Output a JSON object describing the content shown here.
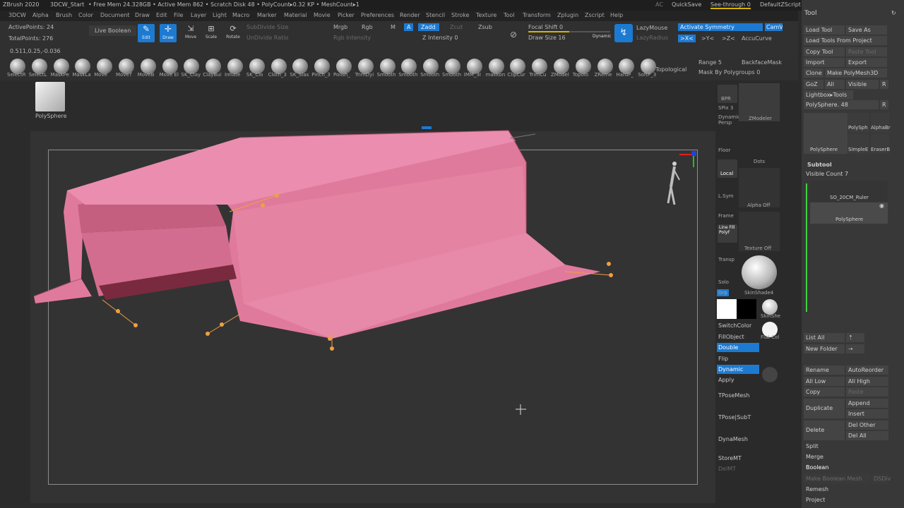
{
  "titlebar": {
    "app": "ZBrush 2020",
    "doc": "3DCW_Start",
    "stats": "• Free Mem 24.328GB • Active Mem 862 • Scratch Disk 48 • PolyCount▸0.32 KP • MeshCount▸1",
    "ac": "AC",
    "quicksave": "QuickSave",
    "seethrough": "See-through 0",
    "script": "DefaultZScript"
  },
  "menu": [
    "3DCW",
    "Alpha",
    "Brush",
    "Color",
    "Document",
    "Draw",
    "Edit",
    "File",
    "Layer",
    "Light",
    "Macro",
    "Marker",
    "Material",
    "Movie",
    "Picker",
    "Preferences",
    "Render",
    "Stencil",
    "Stroke",
    "Texture",
    "Tool",
    "Transform",
    "Zplugin",
    "Zscript",
    "Help"
  ],
  "info": {
    "active_points": "ActivePoints: 24",
    "total_points": "TotalPoints: 276",
    "coords": "0.511,0.25,-0.036"
  },
  "topbar": {
    "live_boolean": "Live Boolean",
    "edit": "Edit",
    "draw": "Draw",
    "move": "Move",
    "scale": "Scale",
    "rotate": "Rotate",
    "subdivide_size": "SubDivide Size",
    "undivide_ratio": "UnDivide Ratio",
    "mrgb": "Mrgb",
    "rgb": "Rgb",
    "m": "M",
    "rgb_intensity": "Rgb Intensity",
    "a": "A",
    "zadd": "Zadd",
    "zsub": "Zsub",
    "zcut": "Zcut",
    "z_intensity": "Z Intensity 0",
    "focal_shift": "Focal Shift 0",
    "draw_size": "Draw Size 16",
    "dynamic": "Dynamic",
    "lazymouse": "LazyMouse",
    "lazyradius": "LazyRadius",
    "activate_symmetry": "Activate Symmetry",
    "cam": "CamV",
    "x_axis": ">X<",
    "y_axis": ">Y<",
    "accucurve": "AccuCurve",
    "range": "Range 5",
    "backface_mask": "BackfaceMask",
    "mask_by_polygroups": "Mask By Polygroups 0",
    "topological": "Topological"
  },
  "brushes": [
    {
      "label": "SelectR"
    },
    {
      "label": "SelectL"
    },
    {
      "label": "MaskPe"
    },
    {
      "label": "MaskLa"
    },
    {
      "label": "Move"
    },
    {
      "label": "MoveT"
    },
    {
      "label": "MoveB"
    },
    {
      "label": "Move El"
    },
    {
      "label": "SK_Clay"
    },
    {
      "label": "ClayBui"
    },
    {
      "label": "Inflate"
    },
    {
      "label": "SK_Clo"
    },
    {
      "label": "Cloth_3"
    },
    {
      "label": "SK_Slas"
    },
    {
      "label": "Pinch_3"
    },
    {
      "label": "Polish_"
    },
    {
      "label": "TrimDyi"
    },
    {
      "label": "Smooth"
    },
    {
      "label": "Smooth"
    },
    {
      "label": "Smooth"
    },
    {
      "label": "Smooth"
    },
    {
      "label": "IMM_3I"
    },
    {
      "label": "makkon"
    },
    {
      "label": "ClipCur"
    },
    {
      "label": "TrimCu"
    },
    {
      "label": "ZModel"
    },
    {
      "label": "Topolo"
    },
    {
      "label": "ZReme"
    },
    {
      "label": "HardP_"
    },
    {
      "label": "SoftP_3"
    }
  ],
  "leftshelf": {
    "tool_name": "PolySphere"
  },
  "rightshelf": {
    "bpr": "BPR",
    "spix": "SPix 3",
    "dynamic_persp": "Dynamic Persp",
    "floor": "Floor",
    "local": "Local",
    "lsym": "L.Sym",
    "frame": "Frame",
    "line_fill": "Line Fill PolyF",
    "transp": "Transp",
    "solo": "Solo",
    "zmodeler": "ZModeler",
    "dots": "Dots",
    "alpha_off": "Alpha Off",
    "texture_off": "Texture Off",
    "skinshade": "SkinShade4",
    "grp": "Grp",
    "switch_color": "SwitchColor",
    "fill_object": "FillObject",
    "double": "Double",
    "flip": "Flip",
    "dynamic": "Dynamic",
    "apply": "Apply",
    "tposemesh": "TPoseMesh",
    "tpose_subt": "TPose|SubT",
    "dynamesh": "DynaMesh",
    "storemt": "StoreMT",
    "delmt": "DelMT",
    "flat_color": "Flat Col",
    "skin_she": "SkinShe"
  },
  "tool_panel": {
    "title": "Tool",
    "load_tool": "Load Tool",
    "save_as": "Save As",
    "load_from_project": "Load Tools From Project",
    "copy_tool": "Copy Tool",
    "paste_tool": "Paste Tool",
    "import": "Import",
    "export": "Export",
    "clone": "Clone",
    "make_polymesh": "Make PolyMesh3D",
    "goz": "GoZ",
    "all": "All",
    "visible": "Visible",
    "r": "R",
    "lightbox_tools": "Lightbox▸Tools",
    "polysphere_slider": "PolySphere. 48",
    "thumbs": [
      "PolySphere",
      "PolySph",
      "AlphaBr",
      "SimpleE",
      "EraserB"
    ],
    "subtool": "Subtool",
    "visible_count": "Visible Count 7",
    "subtools": [
      "SO_20CM_Ruler",
      "PolySphere"
    ],
    "list_all": "List All",
    "new_folder": "New Folder",
    "rename": "Rename",
    "auto_reorder": "AutoReorder",
    "all_low": "All Low",
    "all_high": "All High",
    "copy": "Copy",
    "paste": "Paste",
    "duplicate": "Duplicate",
    "append": "Append",
    "insert": "Insert",
    "delete": "Delete",
    "del_other": "Del Other",
    "del_all": "Del All",
    "split": "Split",
    "merge": "Merge",
    "boolean": "Boolean",
    "make_boolean_mesh": "Make Boolean Mesh",
    "dsdiv": "DSDiv",
    "remesh": "Remesh",
    "project": "Project"
  },
  "colors": {
    "accent": "#1d7ad1",
    "mesh_pink": "#e07a9c",
    "point_orange": "#f0a040"
  }
}
